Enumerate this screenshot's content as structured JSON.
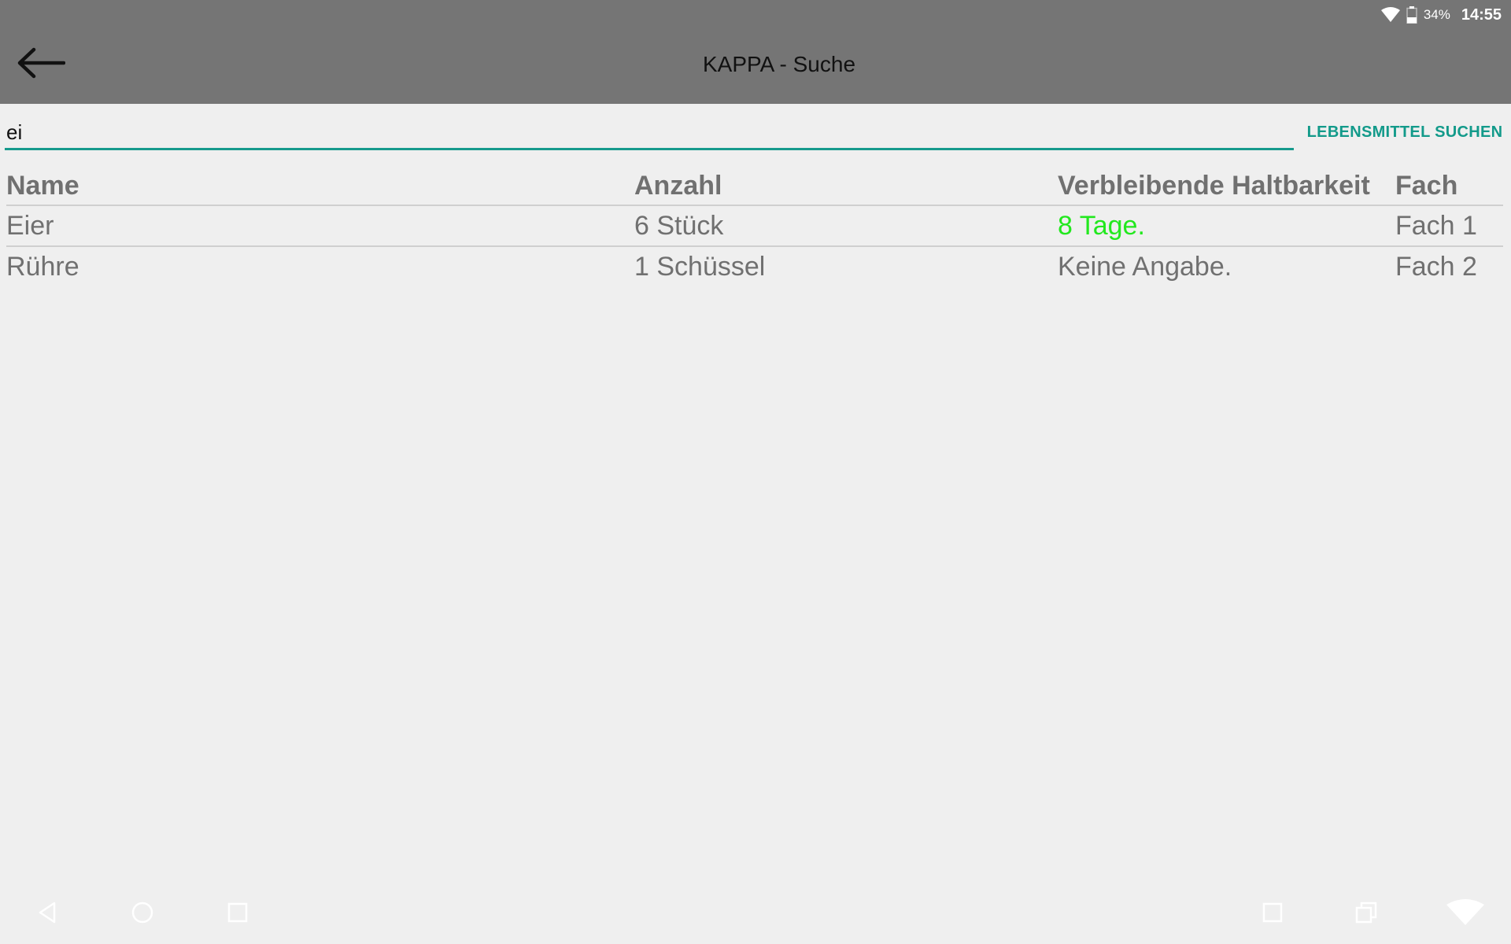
{
  "status_bar": {
    "battery_percent": "34%",
    "time": "14:55"
  },
  "app_bar": {
    "title": "KAPPA - Suche"
  },
  "search": {
    "value": "ei",
    "button_label": "LEBENSMITTEL SUCHEN",
    "accent_color": "#169a8c"
  },
  "table": {
    "headers": [
      "Name",
      "Anzahl",
      "Verbleibende Haltbarkeit",
      "Fach"
    ],
    "rows": [
      {
        "name": "Eier",
        "amount": "6 Stück",
        "shelf_life": "8 Tage.",
        "shelf_life_color": "#22e81e",
        "compartment": "Fach 1"
      },
      {
        "name": "Rühre",
        "amount": "1 Schüssel",
        "shelf_life": "Keine Angabe.",
        "compartment": "Fach 2"
      }
    ]
  },
  "icons": {
    "back": "arrow-left-icon",
    "wifi": "wifi-icon",
    "battery": "battery-icon",
    "nav_back": "triangle-back-icon",
    "nav_home": "circle-home-icon",
    "nav_recents": "square-recents-icon",
    "nav_extra_square": "square-icon",
    "nav_multiwindow": "multiwindow-icon",
    "nav_wifi": "wifi-large-icon"
  }
}
